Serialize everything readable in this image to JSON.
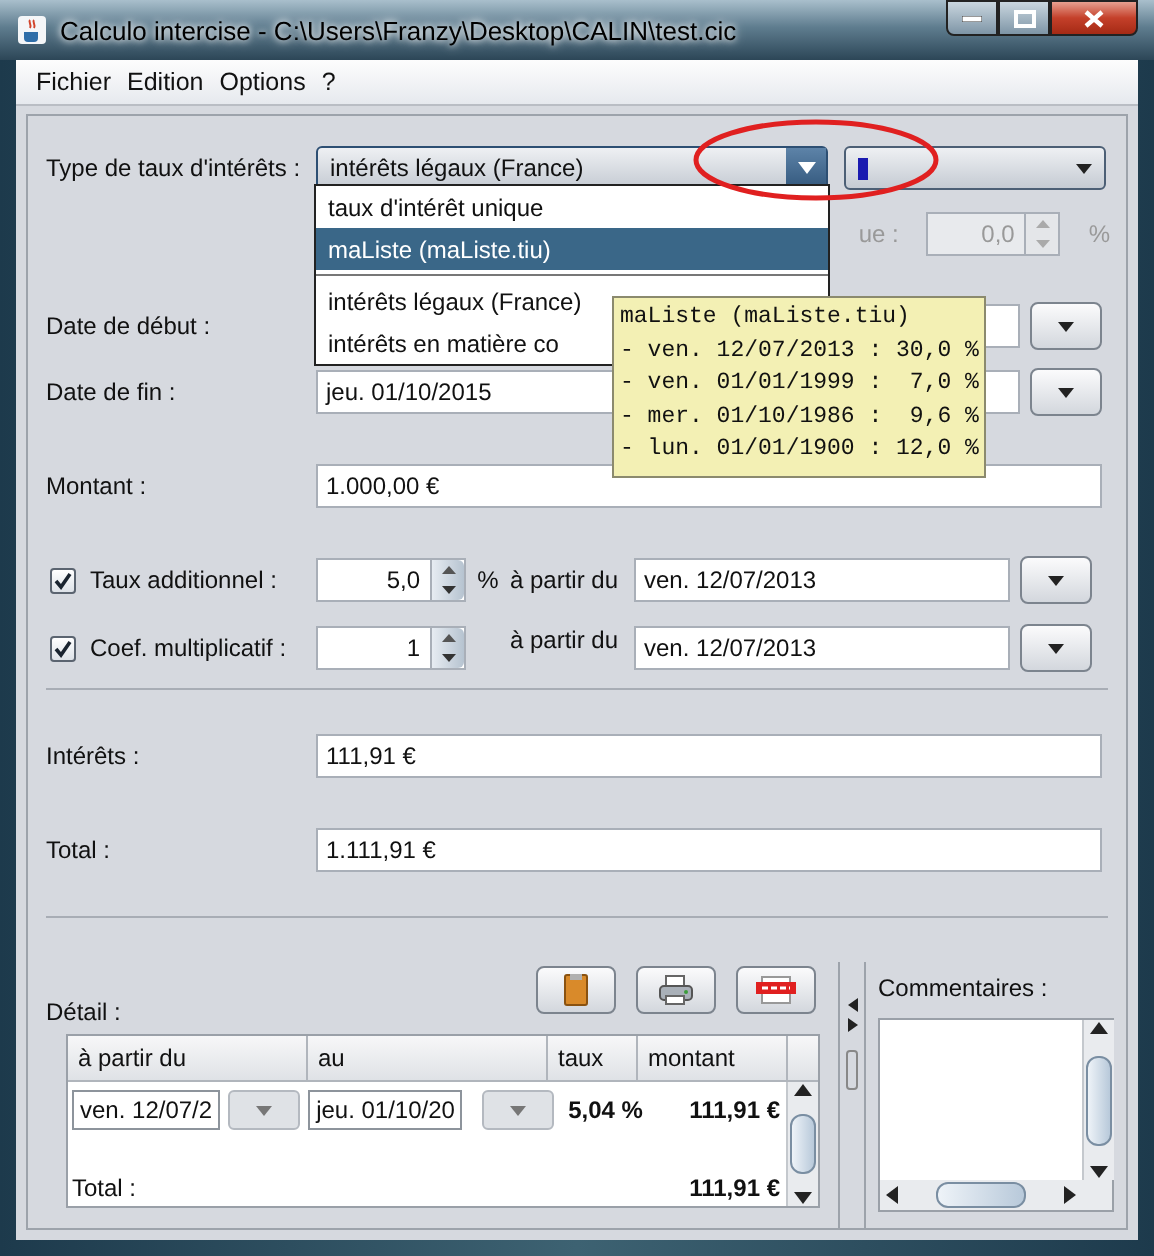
{
  "window": {
    "title": "Calculo intercise - C:\\Users\\Franzy\\Desktop\\CALIN\\test.cic"
  },
  "menu": [
    "Fichier",
    "Edition",
    "Options",
    "?"
  ],
  "rate_type": {
    "label": "Type de taux d'intérêts :",
    "value": "intérêts légaux (France)",
    "expanded": true,
    "options": [
      {
        "label": "taux d'intérêt unique",
        "highlighted": false
      },
      {
        "label": "maListe (maListe.tiu)",
        "highlighted": true
      },
      {
        "label": "intérêts légaux (France)",
        "highlighted": false
      },
      {
        "label": "intérêts en matière co",
        "highlighted": false
      }
    ]
  },
  "tooltip": {
    "title": "maListe (maListe.tiu)",
    "lines": [
      "- ven. 12/07/2013 : 30,0 %",
      "- ven. 01/01/1999 :  7,0 %",
      "- mer. 01/10/1986 :  9,6 %",
      "- lun. 01/01/1900 : 12,0 %"
    ]
  },
  "unique_rate": {
    "label": "ue :",
    "value": "0,0",
    "unit": "%",
    "disabled": true
  },
  "start_date": {
    "label": "Date de début :"
  },
  "end_date": {
    "label": "Date de fin :",
    "value": "jeu. 01/10/2015"
  },
  "amount": {
    "label": "Montant :",
    "value": "1.000,00 €"
  },
  "additional_rate": {
    "label": "Taux additionnel :",
    "checked": true,
    "value": "5,0",
    "unit": "%",
    "from_label": "à partir du",
    "from_date": "ven. 12/07/2013"
  },
  "multiplier": {
    "label": "Coef. multiplicatif :",
    "checked": true,
    "value": "1",
    "from_label": "à partir du",
    "from_date": "ven. 12/07/2013"
  },
  "interest": {
    "label": "Intérêts :",
    "value": "111,91 €"
  },
  "total": {
    "label": "Total :",
    "value": "1.111,91 €"
  },
  "detail": {
    "label": "Détail :",
    "columns": [
      "à partir du",
      "au",
      "taux",
      "montant"
    ],
    "rows": [
      {
        "from": "ven. 12/07/2",
        "to": "jeu. 01/10/20",
        "rate": "5,04 %",
        "amount": "111,91 €"
      }
    ],
    "total_label": "Total :",
    "total_value": "111,91 €"
  },
  "comments": {
    "label": "Commentaires :"
  }
}
